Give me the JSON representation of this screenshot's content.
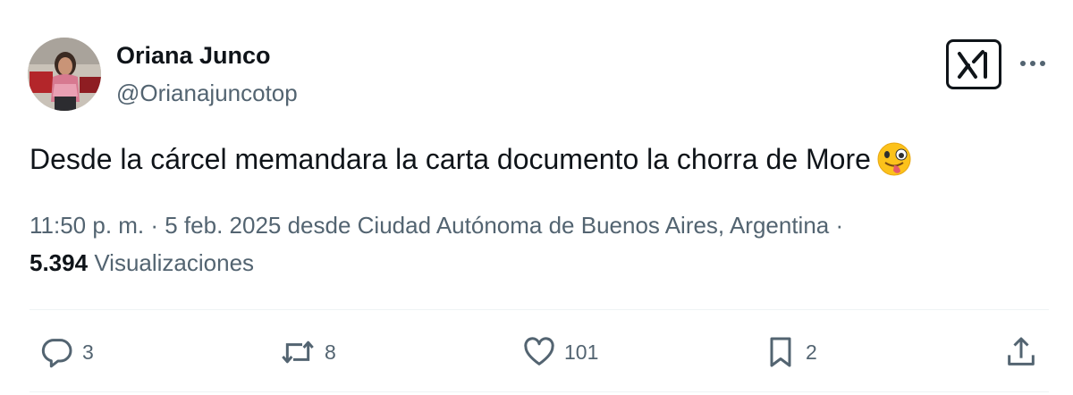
{
  "author": {
    "name": "Oriana Junco",
    "handle": "@Orianajuncotop"
  },
  "tweet": {
    "text": "Desde la cárcel memandara la carta documento la chorra de More",
    "emoji": "winking-face-with-tongue"
  },
  "meta": {
    "time_date_location": "11:50 p. m. · 5 feb. 2025 desde Ciudad Autónoma de Buenos Aires, Argentina",
    "separator": " · ",
    "views_count": "5.394",
    "views_label": "Visualizaciones"
  },
  "actions": {
    "replies": "3",
    "reposts": "8",
    "likes": "101",
    "bookmarks": "2"
  },
  "colors": {
    "text_primary": "#0f1419",
    "text_secondary": "#536471",
    "divider": "#eff3f4"
  }
}
